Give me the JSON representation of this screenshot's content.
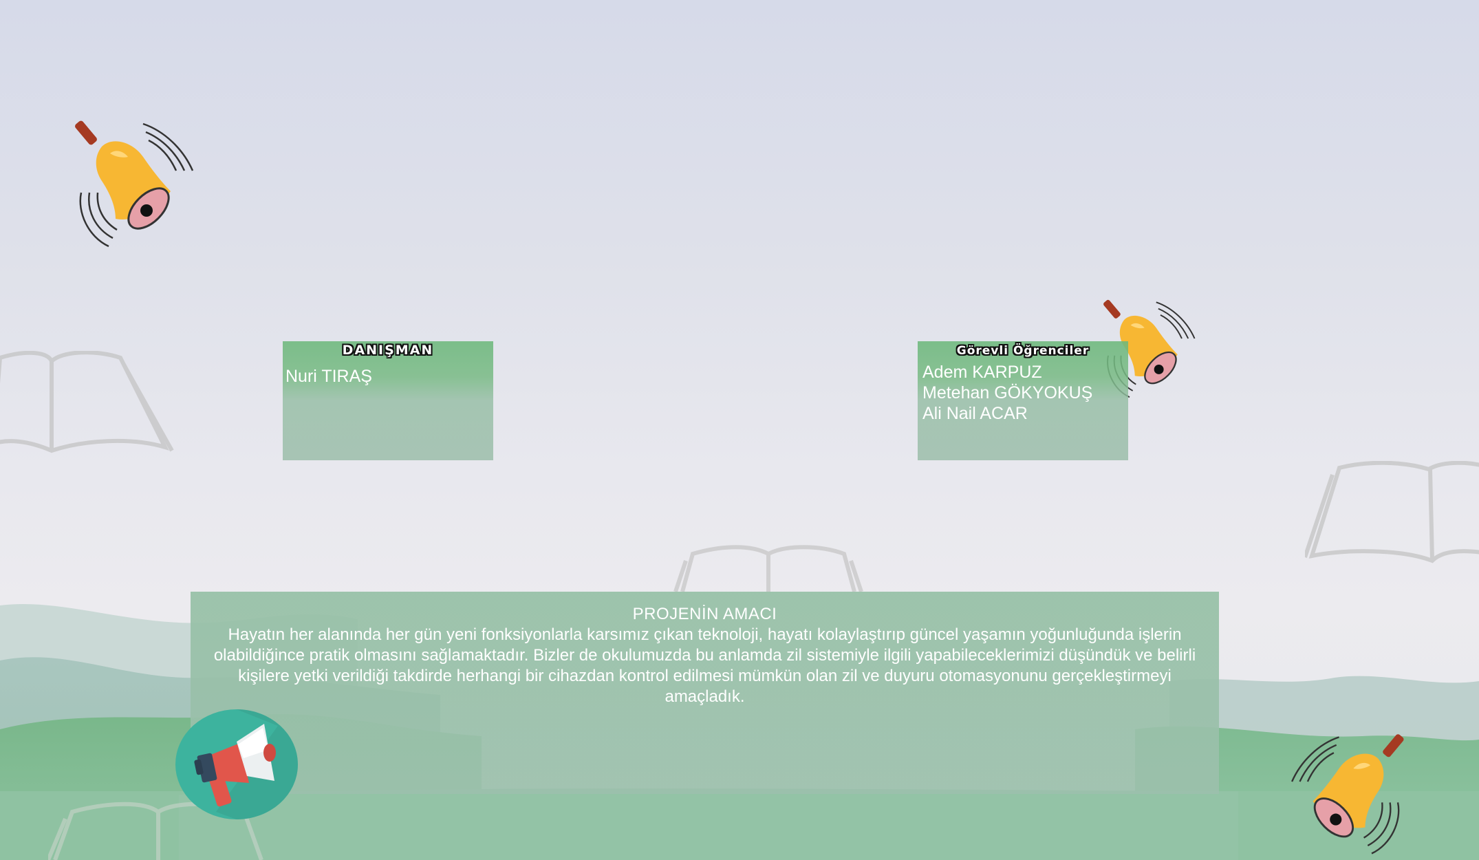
{
  "advisor": {
    "title": "DANIŞMAN",
    "names": [
      "Nuri TIRAŞ"
    ]
  },
  "students": {
    "title": "Görevli Öğrenciler",
    "names": [
      "Adem KARPUZ",
      "Metehan GÖKYOKUŞ",
      "Ali Nail ACAR"
    ]
  },
  "purpose": {
    "title": "PROJENİN AMACI",
    "text": "Hayatın her alanında her gün yeni fonksiyonlarla karsımız çıkan teknoloji, hayatı kolaylaştırıp güncel yaşamın yoğunluğunda işlerin olabildiğince pratik olmasını sağlamaktadır. Bizler de okulumuzda bu anlamda zil sistemiyle ilgili yapabileceklerimizi düşündük ve belirli kişilere yetki verildiği takdirde herhangi bir cihazdan kontrol edilmesi mümkün olan zil ve duyuru otomasyonunu gerçekleştirmeyi amaçladık."
  },
  "icons": {
    "bells": [
      "bell-icon",
      "bell-icon",
      "bell-icon"
    ],
    "megaphone": "megaphone-icon",
    "books": [
      "open-book-icon",
      "open-book-icon",
      "open-book-icon",
      "open-book-icon"
    ]
  },
  "colors": {
    "panel_green": "#7db98a",
    "panel_gray_green": "#9cbfaa",
    "bell_gold": "#f7b733",
    "megaphone_teal": "#3db39e"
  }
}
